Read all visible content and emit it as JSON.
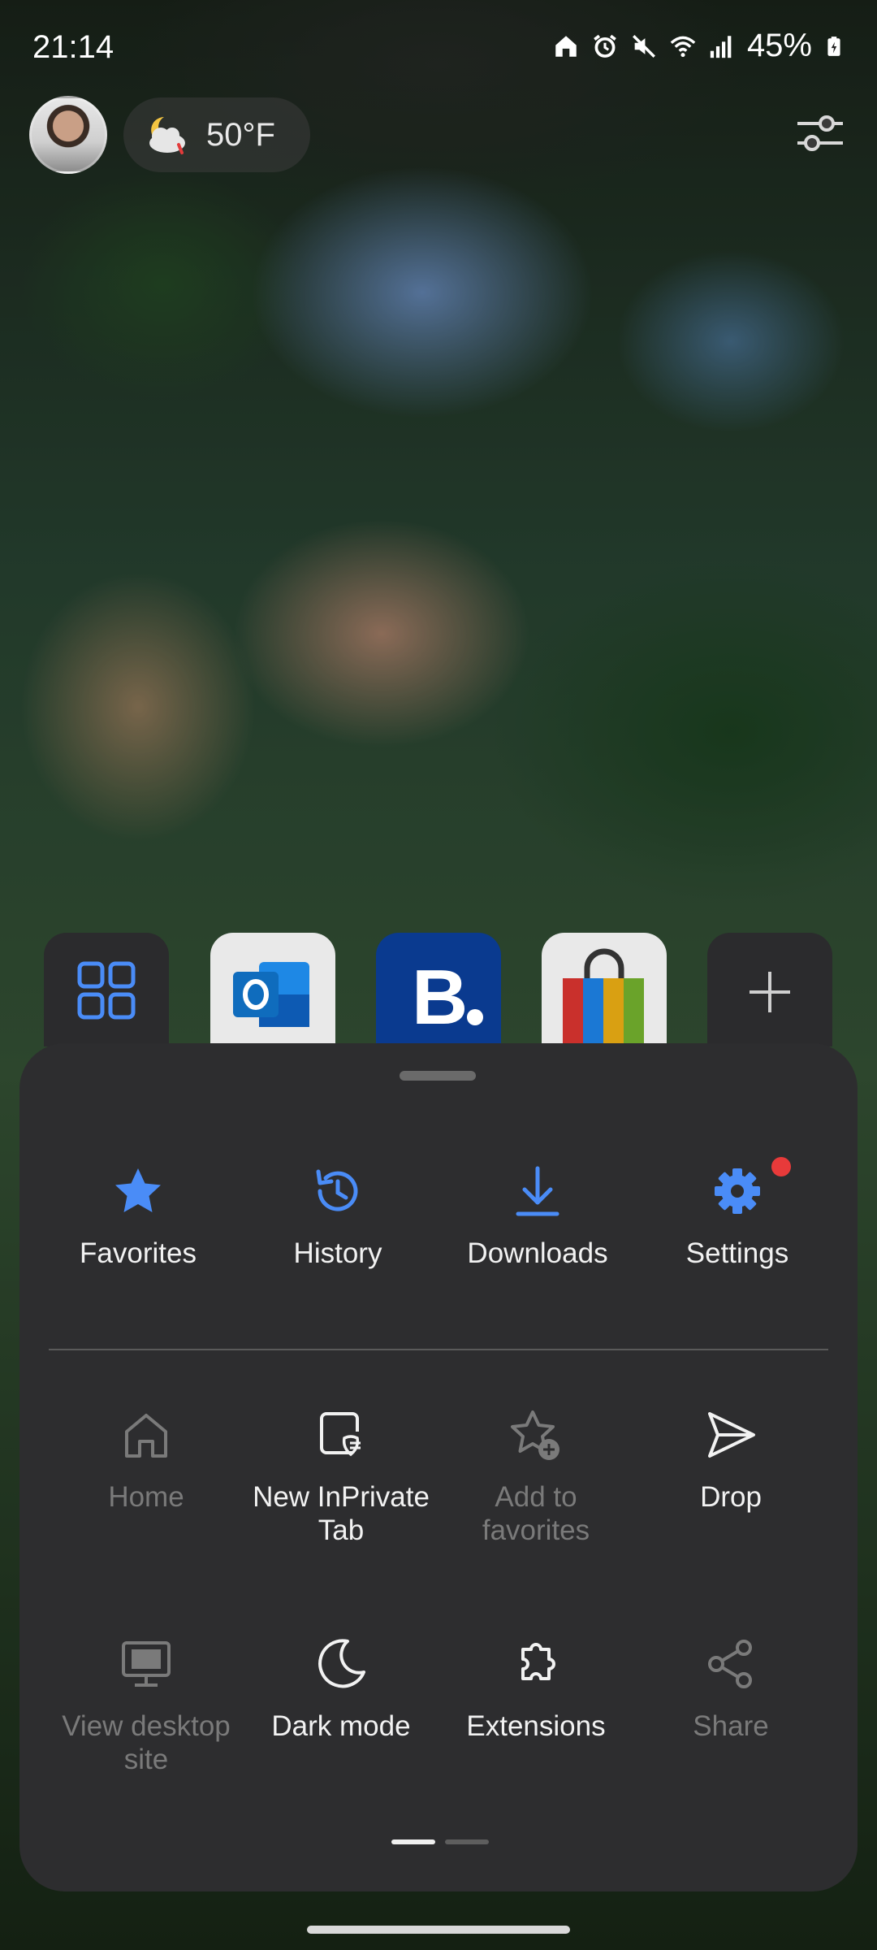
{
  "status_bar": {
    "time": "21:14",
    "battery": "45%",
    "icons": [
      "home-icon",
      "alarm-icon",
      "mute-icon",
      "wifi-icon",
      "signal-icon",
      "battery-charging-icon"
    ]
  },
  "top_bar": {
    "weather_temp": "50°F",
    "weather_icon": "partly-cloudy-night-icon"
  },
  "quick_links": [
    {
      "name": "apps-grid",
      "icon": "grid-icon"
    },
    {
      "name": "outlook",
      "icon": "outlook-icon"
    },
    {
      "name": "booking",
      "icon": "booking-icon"
    },
    {
      "name": "shopping",
      "icon": "shopping-bag-icon"
    },
    {
      "name": "add",
      "icon": "plus-icon"
    }
  ],
  "menu": {
    "primary": [
      {
        "label": "Favorites",
        "icon": "star-icon"
      },
      {
        "label": "History",
        "icon": "history-icon"
      },
      {
        "label": "Downloads",
        "icon": "download-icon"
      },
      {
        "label": "Settings",
        "icon": "gear-icon"
      }
    ],
    "row2": [
      {
        "label": "Home",
        "icon": "home-icon",
        "enabled": false
      },
      {
        "label": "New InPrivate Tab",
        "icon": "inprivate-tab-icon",
        "enabled": true
      },
      {
        "label": "Add to favorites",
        "icon": "star-add-icon",
        "enabled": false
      },
      {
        "label": "Drop",
        "icon": "send-icon",
        "enabled": true
      }
    ],
    "row3": [
      {
        "label": "View desktop site",
        "icon": "desktop-icon",
        "enabled": false
      },
      {
        "label": "Dark mode",
        "icon": "moon-icon",
        "enabled": true
      },
      {
        "label": "Extensions",
        "icon": "puzzle-icon",
        "enabled": true
      },
      {
        "label": "Share",
        "icon": "share-icon",
        "enabled": false
      }
    ],
    "page_indicator": {
      "current": 1,
      "total": 2
    }
  },
  "colors": {
    "accent": "#4a8cf7",
    "sheet_bg": "#2d2d2f",
    "badge": "#e83a3a"
  }
}
